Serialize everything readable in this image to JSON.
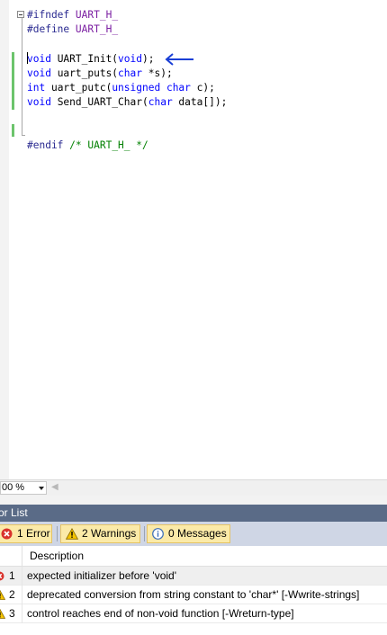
{
  "editor": {
    "lines": {
      "l1": {
        "directive": "#ifndef",
        "name": "UART_H_"
      },
      "l2": {
        "directive": "#define",
        "name": "UART_H_"
      },
      "l3": {
        "type": "void",
        "func": " UART_Init(",
        "param": "void",
        "tail": ");"
      },
      "l4": {
        "type": "void",
        "func": " uart_puts(",
        "param": "char",
        "tail": " *s);"
      },
      "l5": {
        "type": "int",
        "func": " uart_putc(",
        "param1": "unsigned",
        "param2": "char",
        "tail": " c);"
      },
      "l6": {
        "type": "void",
        "func": " Send_UART_Char(",
        "param": "char",
        "tail": " data[]);"
      },
      "l7": {
        "directive": "#endif",
        "comment": "/* UART_H_ */"
      }
    },
    "annotation_icon": "left-arrow-icon",
    "accent_arrow_color": "#1a3fd6"
  },
  "status": {
    "zoom": "00 %"
  },
  "error_list": {
    "title": "rror List",
    "filters": {
      "errors": "1 Error",
      "warnings": "2 Warnings",
      "messages": "0 Messages"
    },
    "column_description": "Description",
    "rows": [
      {
        "num": "1",
        "severity": "error",
        "description": "expected initializer before 'void'"
      },
      {
        "num": "2",
        "severity": "warning",
        "description": "deprecated conversion from string constant to 'char*' [-Wwrite-strings]"
      },
      {
        "num": "3",
        "severity": "warning",
        "description": "control reaches end of non-void function [-Wreturn-type]"
      }
    ]
  }
}
